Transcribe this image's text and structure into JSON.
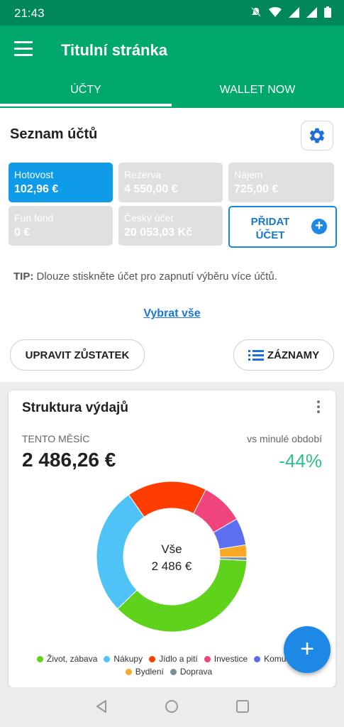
{
  "status_bar": {
    "time": "21:43"
  },
  "app_bar": {
    "title": "Titulní stránka",
    "tabs": [
      {
        "label": "ÚČTY",
        "active": true
      },
      {
        "label": "WALLET NOW",
        "active": false
      }
    ]
  },
  "accounts": {
    "title": "Seznam účtů",
    "items": [
      {
        "name": "Hotovost",
        "balance": "102,96 €",
        "active": true
      },
      {
        "name": "Rezerva",
        "balance": "4 550,00 €",
        "active": false
      },
      {
        "name": "Nájem",
        "balance": "725,00 €",
        "active": false
      },
      {
        "name": "Fun fond",
        "balance": "0 €",
        "active": false
      },
      {
        "name": "Český účet",
        "balance": "20 053,03 Kč",
        "active": false
      }
    ],
    "add_line1": "PŘIDAT",
    "add_line2": "ÚČET",
    "tip_bold": "TIP:",
    "tip_text": " Dlouze stiskněte účet pro zapnutí výběru více účtů.",
    "select_all": "Vybrat vše",
    "adjust_balance": "UPRAVIT ZŮSTATEK",
    "records": "ZÁZNAMY"
  },
  "expenses": {
    "title": "Struktura výdajů",
    "period": "TENTO MĚSÍC",
    "total": "2 486,26 €",
    "compare_label": "vs minulé období",
    "change": "-44%",
    "center_line1": "Vše",
    "center_line2": "2 486 €"
  },
  "chart_data": {
    "type": "pie",
    "categories": [
      "Život, zábava",
      "Nákupy",
      "Jídlo a pití",
      "Investice",
      "Komuni…",
      "Bydlení",
      "Doprava"
    ],
    "values": [
      35.5,
      26.5,
      16.5,
      8.8,
      5.6,
      2.5,
      0.7
    ],
    "colors": [
      "#5fd31c",
      "#4fc3f7",
      "#ff3d00",
      "#f0457c",
      "#5c6ff0",
      "#f9a825",
      "#78909c"
    ]
  },
  "colors": {
    "primary": "#00a86b",
    "status": "#00875a",
    "accent": "#1e88e5",
    "positive": "#2bbf8a"
  }
}
